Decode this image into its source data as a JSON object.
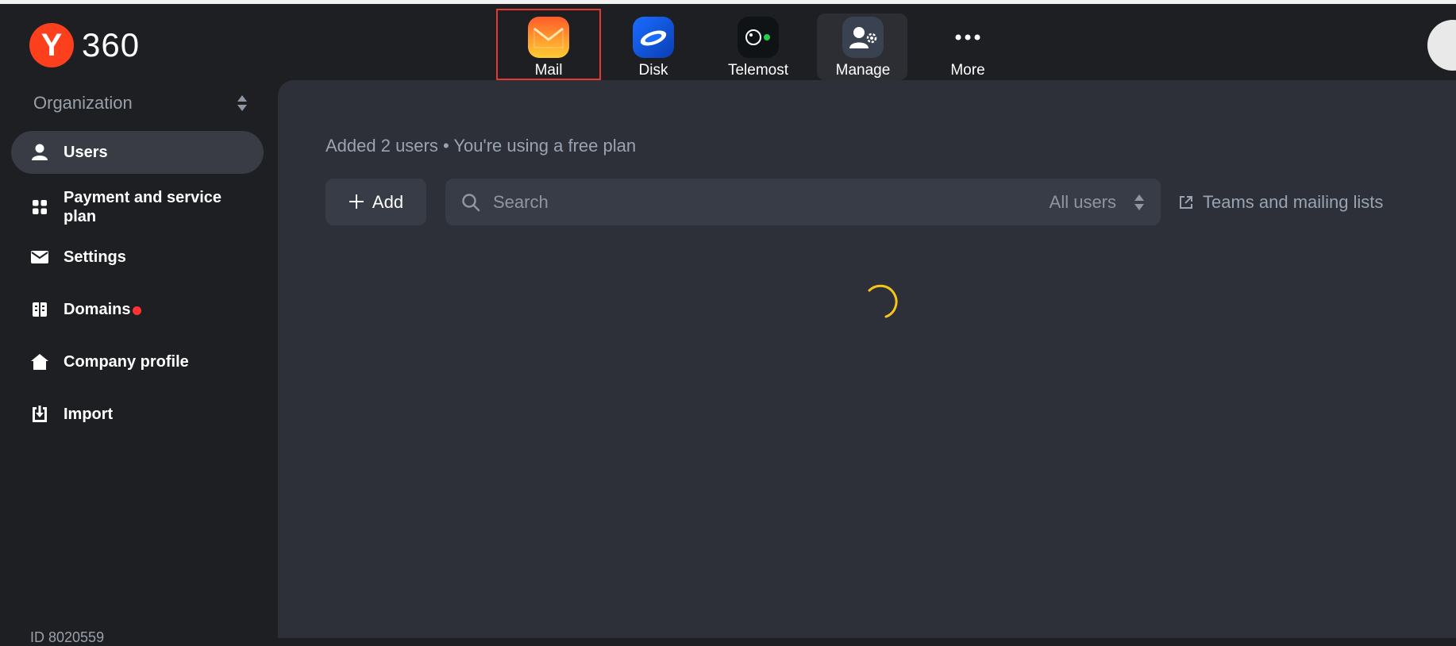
{
  "brand": {
    "logo_letter": "Y",
    "logo_text": "360",
    "logo_color": "#fc3f1d"
  },
  "apps": [
    {
      "label": "Mail",
      "icon": "mail-icon",
      "highlighted": true
    },
    {
      "label": "Disk",
      "icon": "disk-icon"
    },
    {
      "label": "Telemost",
      "icon": "telemost-icon"
    },
    {
      "label": "Manage",
      "icon": "manage-icon",
      "active": true
    },
    {
      "label": "More",
      "icon": "more-dots-icon"
    }
  ],
  "sidebar": {
    "organization_label": "Organization",
    "items": [
      {
        "label": "Users",
        "icon": "user-icon",
        "active": true
      },
      {
        "label": "Payment and service plan",
        "icon": "grid-icon"
      },
      {
        "label": "Settings",
        "icon": "envelope-icon"
      },
      {
        "label": "Domains",
        "icon": "domains-icon",
        "badge_dot": true
      },
      {
        "label": "Company profile",
        "icon": "home-icon"
      },
      {
        "label": "Import",
        "icon": "import-icon"
      }
    ],
    "id_text": "ID 8020559"
  },
  "main": {
    "summary": "Added 2 users • You're using a free plan",
    "add_label": "Add",
    "search_placeholder": "Search",
    "filter_value": "All users",
    "teams_link": "Teams and mailing lists"
  },
  "colors": {
    "accent_yellow": "#f5c518",
    "badge_red": "#ff3333",
    "highlight_border": "#e53935"
  }
}
